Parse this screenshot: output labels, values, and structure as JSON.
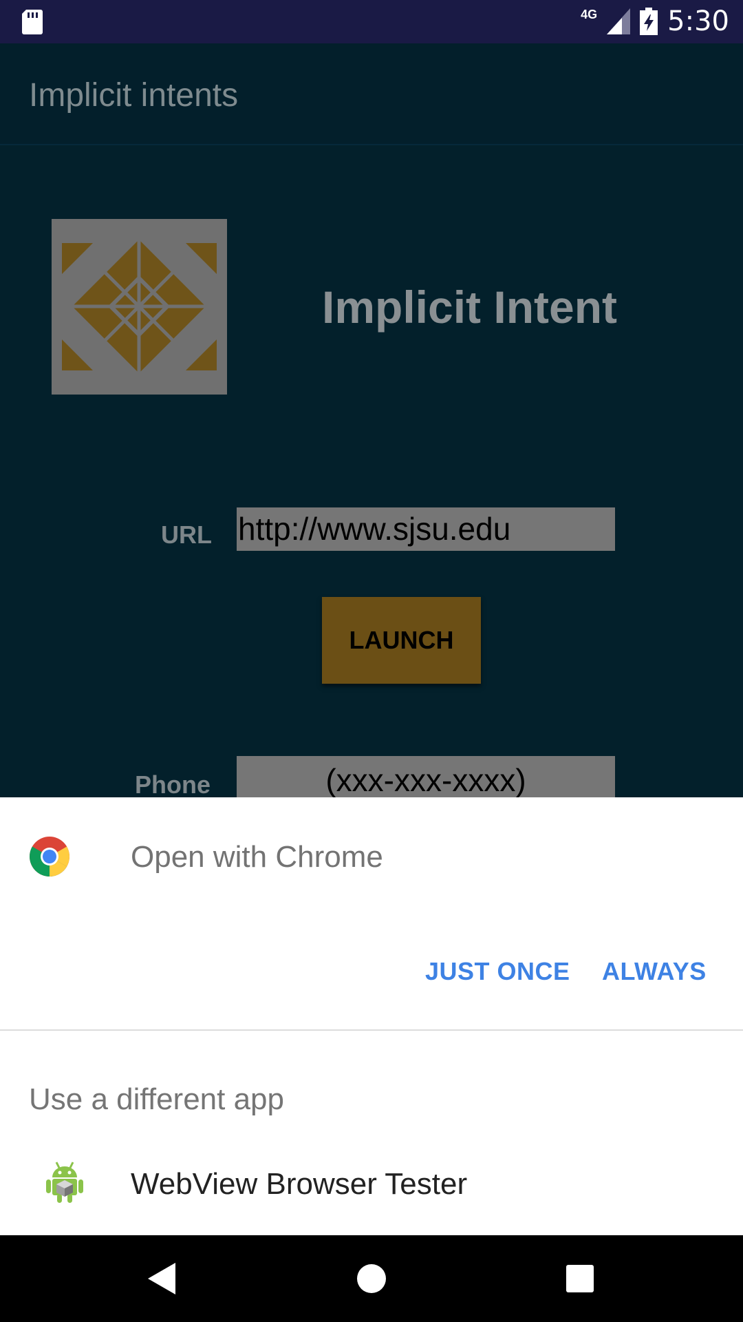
{
  "status_bar": {
    "network": "4G",
    "time": "5:30",
    "icons": [
      "sd-card-icon",
      "signal-icon",
      "battery-charging-icon"
    ]
  },
  "app": {
    "toolbar_title": "Implicit intents",
    "heading": "Implicit Intent",
    "url_label": "URL",
    "url_value": "http://www.sjsu.edu",
    "launch_label": "LAUNCH",
    "phone_label": "Phone",
    "phone_value": "(xxx-xxx-xxxx)"
  },
  "chooser": {
    "title": "Open with Chrome",
    "just_once": "JUST ONCE",
    "always": "ALWAYS",
    "other_header": "Use a different app",
    "apps": [
      {
        "label": "WebView Browser Tester",
        "icon": "android-icon"
      }
    ],
    "colors": {
      "accent": "#3E82E4"
    }
  },
  "nav": {
    "icons": [
      "back-icon",
      "home-icon",
      "recents-icon"
    ]
  }
}
